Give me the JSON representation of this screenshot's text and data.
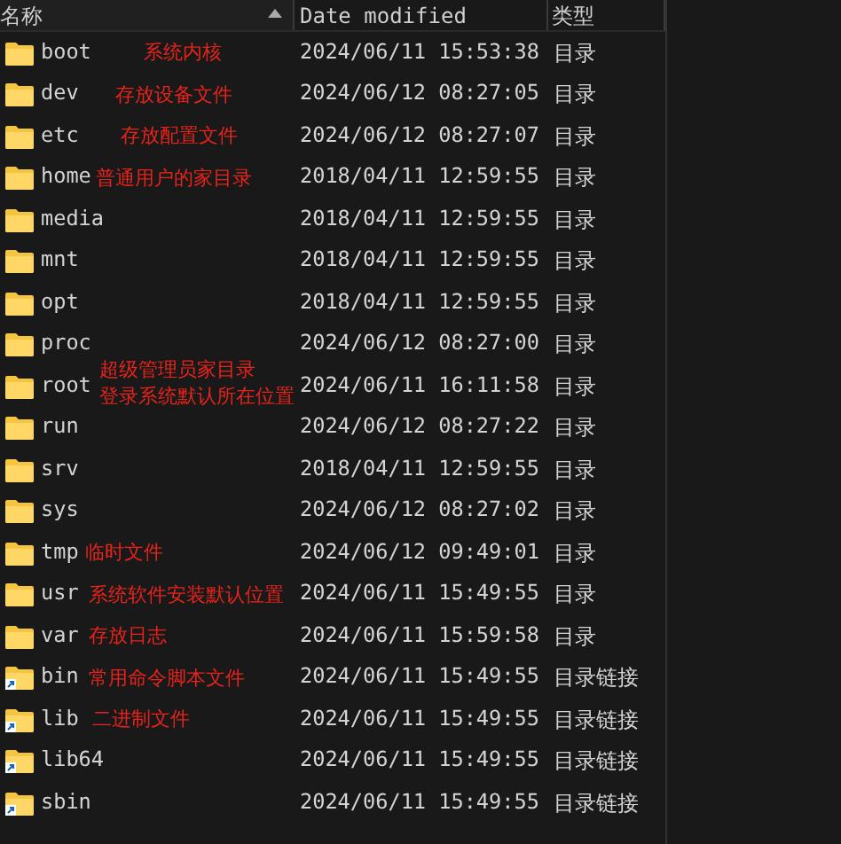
{
  "columns": [
    {
      "label": "名称",
      "sorted": true
    },
    {
      "label": "Date modified",
      "sorted": false
    },
    {
      "label": "类型",
      "sorted": false
    }
  ],
  "rows": [
    {
      "kind": "folder",
      "name": "boot",
      "modified": "2024/06/11 15:53:38",
      "type": "目录",
      "notes": [
        "系统内核"
      ]
    },
    {
      "kind": "folder",
      "name": "dev",
      "modified": "2024/06/12 08:27:05",
      "type": "目录",
      "notes": [
        "存放设备文件"
      ]
    },
    {
      "kind": "folder",
      "name": "etc",
      "modified": "2024/06/12 08:27:07",
      "type": "目录",
      "notes": [
        "存放配置文件"
      ]
    },
    {
      "kind": "folder",
      "name": "home",
      "modified": "2018/04/11 12:59:55",
      "type": "目录",
      "notes": [
        "普通用户的家目录"
      ]
    },
    {
      "kind": "folder",
      "name": "media",
      "modified": "2018/04/11 12:59:55",
      "type": "目录"
    },
    {
      "kind": "folder",
      "name": "mnt",
      "modified": "2018/04/11 12:59:55",
      "type": "目录"
    },
    {
      "kind": "folder",
      "name": "opt",
      "modified": "2018/04/11 12:59:55",
      "type": "目录"
    },
    {
      "kind": "folder",
      "name": "proc",
      "modified": "2024/06/12 08:27:00",
      "type": "目录"
    },
    {
      "kind": "folder",
      "name": "root",
      "modified": "2024/06/11 16:11:58",
      "type": "目录",
      "notes": [
        "超级管理员家目录",
        "登录系统默认所在位置"
      ]
    },
    {
      "kind": "folder",
      "name": "run",
      "modified": "2024/06/12 08:27:22",
      "type": "目录"
    },
    {
      "kind": "folder",
      "name": "srv",
      "modified": "2018/04/11 12:59:55",
      "type": "目录"
    },
    {
      "kind": "folder",
      "name": "sys",
      "modified": "2024/06/12 08:27:02",
      "type": "目录"
    },
    {
      "kind": "folder",
      "name": "tmp",
      "modified": "2024/06/12 09:49:01",
      "type": "目录",
      "notes": [
        "临时文件"
      ]
    },
    {
      "kind": "folder",
      "name": "usr",
      "modified": "2024/06/11 15:49:55",
      "type": "目录",
      "notes": [
        "系统软件安装默认位置"
      ]
    },
    {
      "kind": "folder",
      "name": "var",
      "modified": "2024/06/11 15:59:58",
      "type": "目录",
      "notes": [
        "存放日志"
      ]
    },
    {
      "kind": "link",
      "name": "bin",
      "modified": "2024/06/11 15:49:55",
      "type": "目录链接",
      "notes": [
        "常用命令脚本文件"
      ]
    },
    {
      "kind": "link",
      "name": "lib",
      "modified": "2024/06/11 15:49:55",
      "type": "目录链接",
      "notes": [
        "二进制文件"
      ]
    },
    {
      "kind": "link",
      "name": "lib64",
      "modified": "2024/06/11 15:49:55",
      "type": "目录链接"
    },
    {
      "kind": "link",
      "name": "sbin",
      "modified": "2024/06/11 15:49:55",
      "type": "目录链接"
    }
  ]
}
